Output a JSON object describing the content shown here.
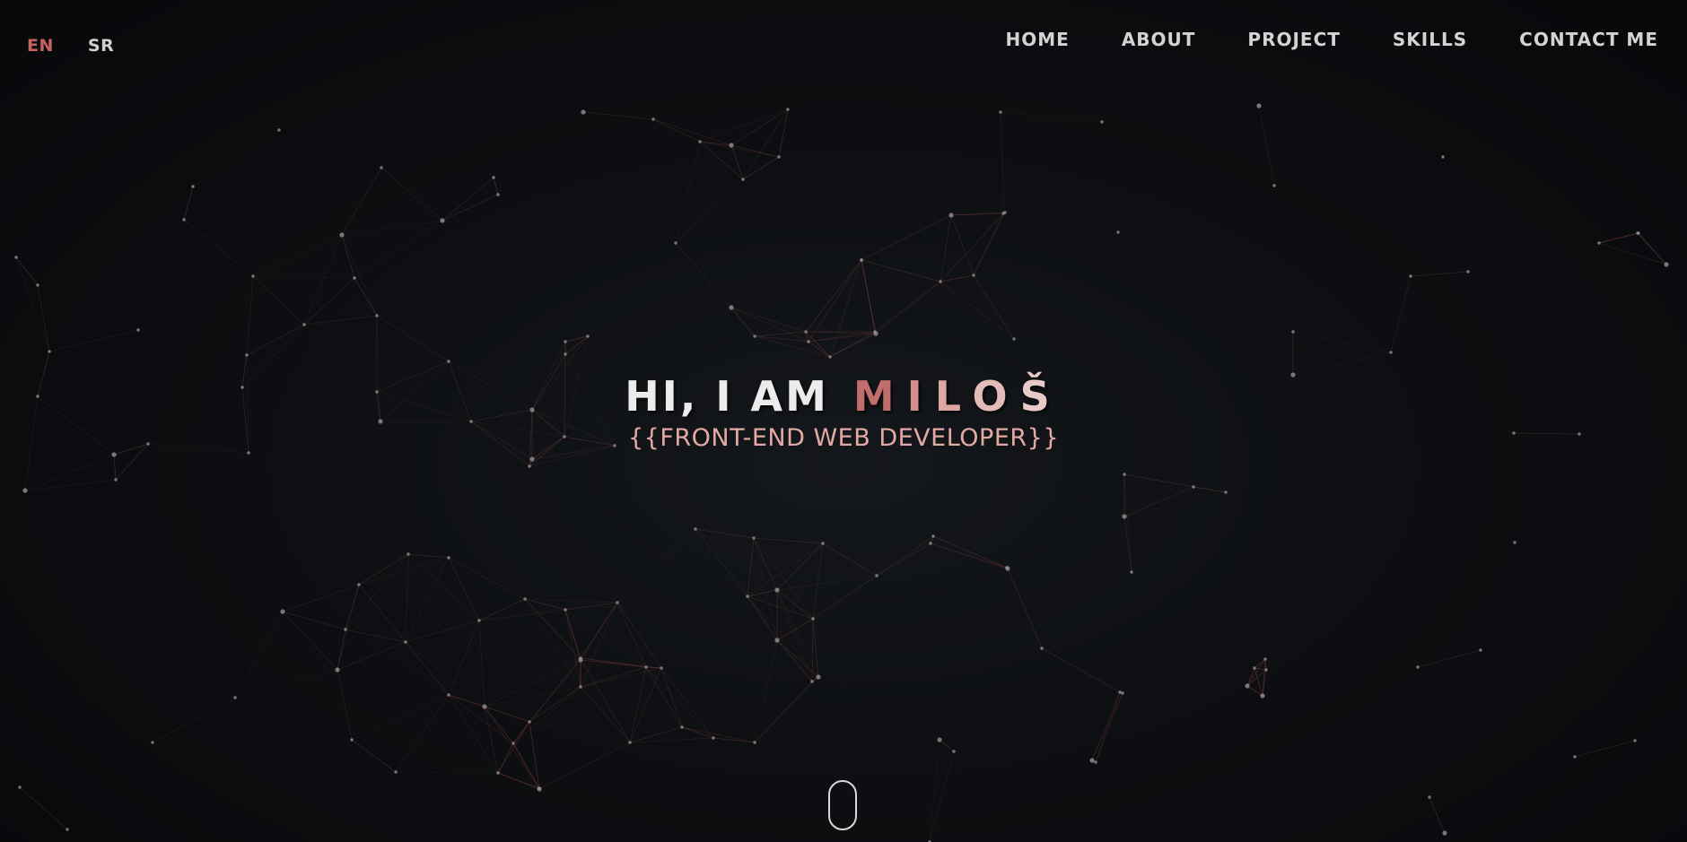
{
  "language_switcher": {
    "options": [
      {
        "label": "EN",
        "active": true
      },
      {
        "label": "SR",
        "active": false
      }
    ],
    "active_color": "#c9615f"
  },
  "nav": {
    "items": [
      "HOME",
      "ABOUT",
      "PROJECT",
      "SKILLS",
      "CONTACT ME"
    ]
  },
  "hero": {
    "greeting": "HI, I AM",
    "name_letters": [
      "M",
      "I",
      "L",
      "O",
      "Š"
    ],
    "subtitle": "{{FRONT-END WEB DEVELOPER}}"
  },
  "scroll_indicator": {
    "icon": "mouse-scroll-icon"
  },
  "background": {
    "type": "particle-network",
    "line_color": "#7a3d3d",
    "node_color": "#9a9a9a"
  }
}
